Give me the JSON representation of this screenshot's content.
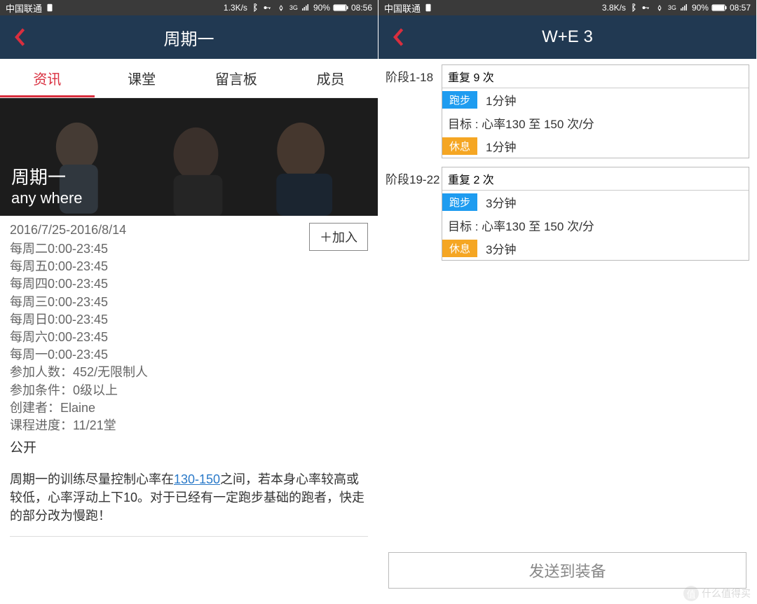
{
  "left": {
    "status": {
      "carrier": "中国联通",
      "speed": "1.3K/s",
      "battery": "90%",
      "time": "08:56",
      "network": "3G"
    },
    "title": "周期一",
    "tabs": [
      "资讯",
      "课堂",
      "留言板",
      "成员"
    ],
    "activeTab": 0,
    "hero": {
      "title": "周期一",
      "subtitle": "any where"
    },
    "dateRange": "2016/7/25-2016/8/14",
    "joinLabel": "＋加入",
    "schedule": [
      "每周二0:00-23:45",
      "每周五0:00-23:45",
      "每周四0:00-23:45",
      "每周三0:00-23:45",
      "每周日0:00-23:45",
      "每周六0:00-23:45",
      "每周一0:00-23:45"
    ],
    "meta": [
      "参加人数：452/无限制人",
      "参加条件：0级以上",
      "创建者：Elaine",
      "课程进度：11/21堂"
    ],
    "visibility": "公开",
    "desc_pre": "周期一的训练尽量控制心率在",
    "desc_link": "130-150",
    "desc_post": "之间，若本身心率较高或较低，心率浮动上下10。对于已经有一定跑步基础的跑者，快走的部分改为慢跑！"
  },
  "right": {
    "status": {
      "carrier": "中国联通",
      "speed": "3.8K/s",
      "battery": "90%",
      "time": "08:57",
      "network": "3G"
    },
    "title": "W+E 3",
    "stages": [
      {
        "label": "阶段1-18",
        "repeat": "重复 9 次",
        "runLabel": "跑步",
        "runVal": "1分钟",
        "target": "目标 : 心率130 至 150 次/分",
        "restLabel": "休息",
        "restVal": "1分钟"
      },
      {
        "label": "阶段19-22",
        "repeat": "重复 2 次",
        "runLabel": "跑步",
        "runVal": "3分钟",
        "target": "目标 : 心率130 至 150 次/分",
        "restLabel": "休息",
        "restVal": "3分钟"
      }
    ],
    "sendLabel": "发送到装备"
  },
  "watermark": "什么值得买"
}
